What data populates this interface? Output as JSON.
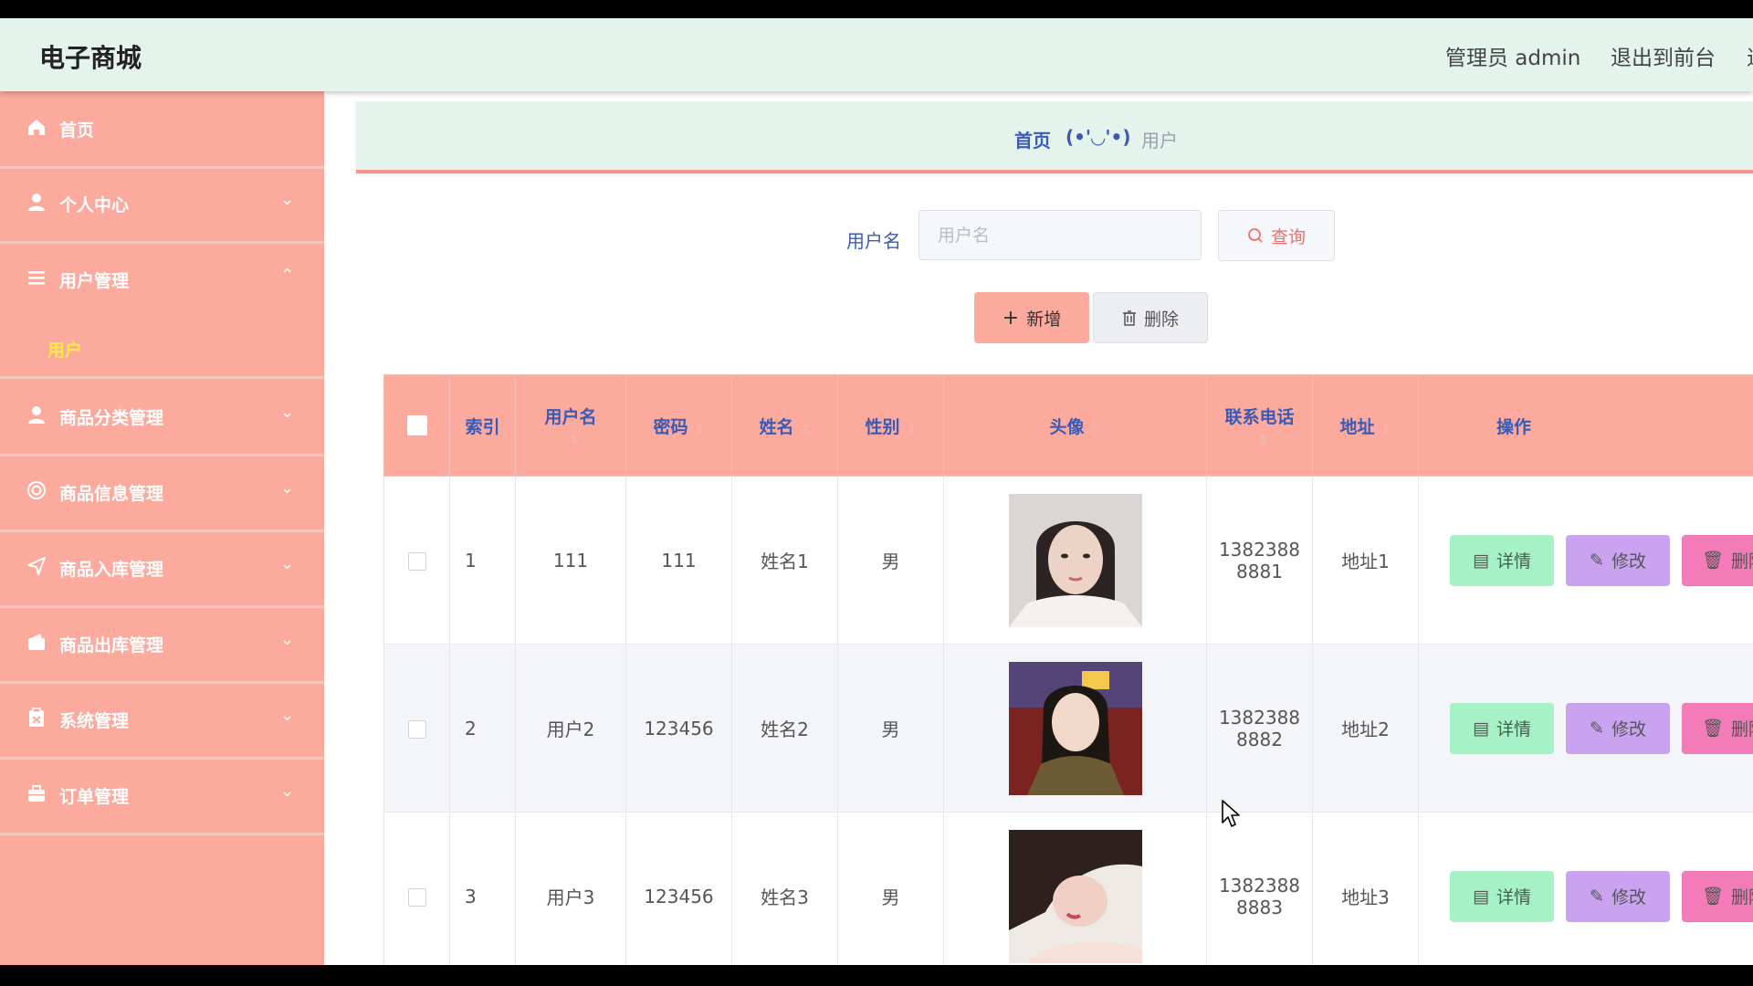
{
  "header": {
    "brand": "电子商城",
    "admin_label": "管理员 admin",
    "exit_label": "退出到前台",
    "cut_label": "退"
  },
  "sidebar": {
    "items": [
      {
        "label": "首页",
        "icon": "home-icon"
      },
      {
        "label": "个人中心",
        "icon": "person-icon"
      },
      {
        "label": "用户管理",
        "icon": "list-icon"
      },
      {
        "label": "商品分类管理",
        "icon": "person-icon"
      },
      {
        "label": "商品信息管理",
        "icon": "circle-icon"
      },
      {
        "label": "商品入库管理",
        "icon": "send-icon"
      },
      {
        "label": "商品出库管理",
        "icon": "wallet-icon"
      },
      {
        "label": "系统管理",
        "icon": "clipboard-icon"
      },
      {
        "label": "订单管理",
        "icon": "briefcase-icon"
      }
    ],
    "sub_item": "用户"
  },
  "breadcrumb": {
    "home": "首页",
    "separator": "(•'◡'•)",
    "current": "用户"
  },
  "search": {
    "label": "用户名",
    "placeholder": "用户名",
    "query_button": "查询"
  },
  "actions": {
    "add": "新增",
    "delete": "删除"
  },
  "table": {
    "columns": [
      "索引",
      "用户名",
      "密码",
      "姓名",
      "性别",
      "头像",
      "联系电话",
      "地址",
      "操作"
    ],
    "rows": [
      {
        "index": "1",
        "username": "111",
        "password": "111",
        "name": "姓名1",
        "gender": "男",
        "phone_a": "1382388",
        "phone_b": "8881",
        "address": "地址1"
      },
      {
        "index": "2",
        "username": "用户2",
        "password": "123456",
        "name": "姓名2",
        "gender": "男",
        "phone_a": "1382388",
        "phone_b": "8882",
        "address": "地址2"
      },
      {
        "index": "3",
        "username": "用户3",
        "password": "123456",
        "name": "姓名3",
        "gender": "男",
        "phone_a": "1382388",
        "phone_b": "8883",
        "address": "地址3"
      }
    ],
    "row_actions": {
      "detail": "详情",
      "edit": "修改",
      "delete": "删除"
    }
  },
  "colors": {
    "accent": "#fca99e",
    "topbar": "#e4f3ec",
    "link": "#3a5bb5",
    "sub_active": "#ffe94d",
    "detail_btn": "#a6f1c6",
    "edit_btn": "#c9a3f0",
    "delete_btn": "#f27bb8"
  }
}
